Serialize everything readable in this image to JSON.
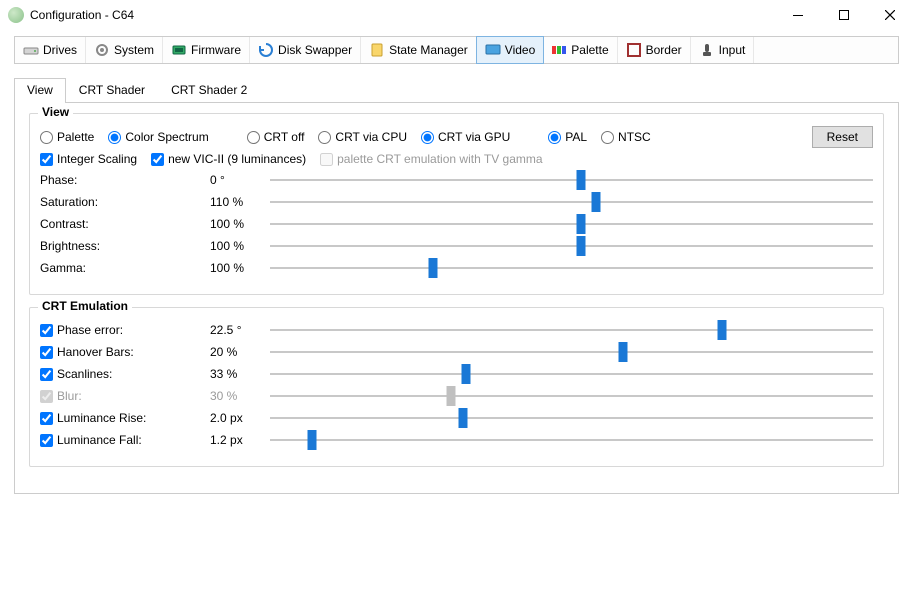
{
  "window": {
    "title": "Configuration - C64"
  },
  "toolbar": {
    "drives": "Drives",
    "system": "System",
    "firmware": "Firmware",
    "disk_swapper": "Disk Swapper",
    "state_manager": "State Manager",
    "video": "Video",
    "palette": "Palette",
    "border": "Border",
    "input": "Input"
  },
  "tabs": {
    "view": "View",
    "crt_shader": "CRT Shader",
    "crt_shader2": "CRT Shader 2"
  },
  "view_group": {
    "title": "View",
    "palette": "Palette",
    "color_spectrum": "Color Spectrum",
    "crt_off": "CRT off",
    "crt_cpu": "CRT via CPU",
    "crt_gpu": "CRT via GPU",
    "pal": "PAL",
    "ntsc": "NTSC",
    "integer_scaling": "Integer Scaling",
    "new_vic": "new VIC-II (9 luminances)",
    "pal_crt_tv": "palette CRT emulation with TV gamma",
    "reset": "Reset",
    "phase_l": "Phase:",
    "phase_v": "0 °",
    "phase_p": 51.5,
    "sat_l": "Saturation:",
    "sat_v": "110 %",
    "sat_p": 54,
    "con_l": "Contrast:",
    "con_v": "100 %",
    "con_p": 51.5,
    "bri_l": "Brightness:",
    "bri_v": "100 %",
    "bri_p": 51.5,
    "gam_l": "Gamma:",
    "gam_v": "100 %",
    "gam_p": 27
  },
  "crt_group": {
    "title": "CRT Emulation",
    "pherr_l": "Phase error:",
    "pherr_v": "22.5 °",
    "pherr_p": 75,
    "hano_l": "Hanover Bars:",
    "hano_v": "20 %",
    "hano_p": 58.5,
    "scan_l": "Scanlines:",
    "scan_v": "33 %",
    "scan_p": 32.5,
    "blur_l": "Blur:",
    "blur_v": "30 %",
    "blur_p": 30,
    "lrise_l": "Luminance Rise:",
    "lrise_v": "2.0 px",
    "lrise_p": 32,
    "lfall_l": "Luminance Fall:",
    "lfall_v": "1.2 px",
    "lfall_p": 7
  }
}
